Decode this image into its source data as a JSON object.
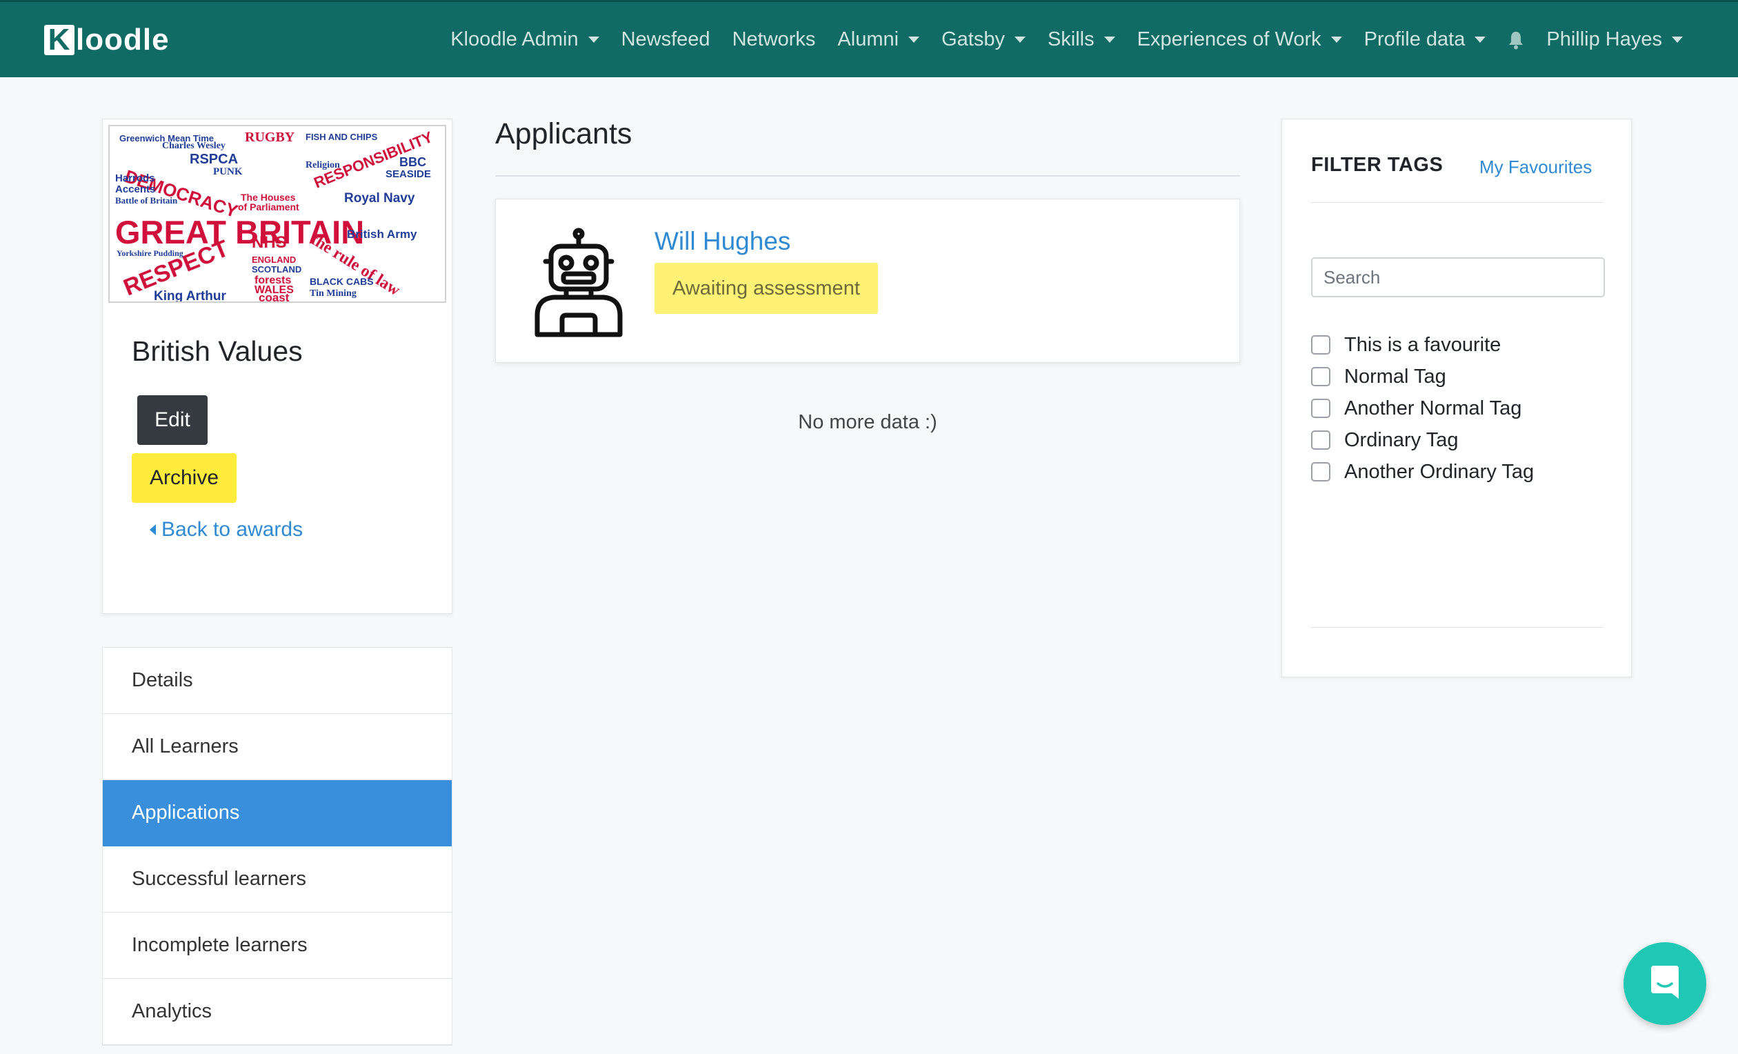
{
  "brand": {
    "name": "Kloodle",
    "box_letter": "K",
    "rest": "loodle"
  },
  "nav": {
    "items": [
      {
        "label": "Kloodle Admin",
        "dropdown": true
      },
      {
        "label": "Newsfeed",
        "dropdown": false
      },
      {
        "label": "Networks",
        "dropdown": false
      },
      {
        "label": "Alumni",
        "dropdown": true
      },
      {
        "label": "Gatsby",
        "dropdown": true
      },
      {
        "label": "Skills",
        "dropdown": true
      },
      {
        "label": "Experiences of Work",
        "dropdown": true
      },
      {
        "label": "Profile data",
        "dropdown": true
      }
    ],
    "notification_icon": "bell-icon",
    "user": "Phillip Hayes"
  },
  "award": {
    "title": "British Values",
    "image_text": {
      "headline": "GREAT BRITAIN",
      "words": [
        "DEMOCRACY",
        "RESPECT",
        "NHS",
        "the rule of law",
        "RUGBY",
        "BBC",
        "Royal Navy",
        "British Army",
        "King Arthur",
        "RSPCA",
        "Harrods",
        "coast",
        "forests",
        "WALES",
        "SCOTLAND",
        "ENGLAND",
        "FISH AND CHIPS",
        "PUNK",
        "Religion",
        "SEASIDE"
      ]
    },
    "edit_label": "Edit",
    "archive_label": "Archive",
    "back_label": "Back to awards"
  },
  "side_menu": {
    "items": [
      {
        "label": "Details",
        "active": false
      },
      {
        "label": "All Learners",
        "active": false
      },
      {
        "label": "Applications",
        "active": true
      },
      {
        "label": "Successful learners",
        "active": false
      },
      {
        "label": "Incomplete learners",
        "active": false
      },
      {
        "label": "Analytics",
        "active": false
      }
    ]
  },
  "applicants": {
    "title": "Applicants",
    "list": [
      {
        "name": "Will Hughes",
        "status": "Awaiting assessment",
        "avatar_icon": "robot-icon"
      }
    ],
    "end_message": "No more data :)"
  },
  "filter": {
    "title": "FILTER TAGS",
    "favourites_label": "My Favourites",
    "search_placeholder": "Search",
    "tags": [
      {
        "label": "This is a favourite",
        "checked": false
      },
      {
        "label": "Normal Tag",
        "checked": false
      },
      {
        "label": "Another Normal Tag",
        "checked": false
      },
      {
        "label": "Ordinary Tag",
        "checked": false
      },
      {
        "label": "Another Ordinary Tag",
        "checked": false
      }
    ]
  },
  "colors": {
    "navbar": "#0f6b63",
    "link": "#2f8ad4",
    "active_menu": "#3a8fdd",
    "archive_button": "#ffeb3b",
    "status_badge": "#fff176",
    "chat_button": "#1fc8b4"
  },
  "chat": {
    "icon": "chat-icon"
  }
}
